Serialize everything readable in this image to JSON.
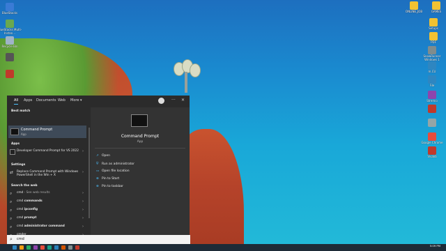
{
  "desktop": {
    "icons_left": [
      {
        "label": "BlueStacks",
        "color": "#3a7bd5"
      },
      {
        "label": "BlueStacks Multi-Instan...",
        "color": "#6aa84f"
      },
      {
        "label": "Recycle Bin",
        "color": "#9fb3c8"
      },
      {
        "label": "",
        "color": "#555555"
      },
      {
        "label": "",
        "color": "#c0392b"
      }
    ],
    "icons_right": [
      {
        "label": "ONLINE_JOB",
        "color": "#f1c232"
      },
      {
        "label": "GAMES",
        "color": "#f1c232"
      },
      {
        "label": "Setups",
        "color": "#f1c232"
      },
      {
        "label": "PDF",
        "color": "#f1c232"
      },
      {
        "label": "SnowRunner Windows 1",
        "color": "#7f8c8d"
      },
      {
        "label": "m.CU",
        "color": "#2e86c1"
      },
      {
        "label": "File",
        "color": "#2e86c1"
      },
      {
        "label": "Stremio",
        "color": "#8e44ad"
      },
      {
        "label": "",
        "color": "#c0392b"
      },
      {
        "label": "",
        "color": "#95a5a6"
      },
      {
        "label": "Google Chrome",
        "color": "#e74c3c"
      },
      {
        "label": "Vivaldi",
        "color": "#c0392b"
      }
    ]
  },
  "start": {
    "tabs": [
      "All",
      "Apps",
      "Documents",
      "Web",
      "More ▾"
    ],
    "more_icon": "···",
    "close_icon": "✕",
    "sections": {
      "best_match": "Best match",
      "apps": "Apps",
      "settings": "Settings",
      "search_web": "Search the web"
    },
    "best_match": {
      "title": "Command Prompt",
      "subtitle": "App"
    },
    "apps": [
      {
        "label": "Developer Command Prompt for VS 2022"
      }
    ],
    "settings": [
      {
        "label": "Replace Command Prompt with Windows PowerShell in the Win + X"
      }
    ],
    "web": [
      {
        "label": "cmd",
        "suffix": " - See web results"
      },
      {
        "label": "cmd ",
        "bold": "commands"
      },
      {
        "label": "cmd ",
        "bold": "ipconfig"
      },
      {
        "label": "cmd ",
        "bold": "prompt"
      },
      {
        "label": "cmd ",
        "bold": "administrator command"
      },
      {
        "label": "cmder",
        "bold": ""
      },
      {
        "label": "cmdb",
        "bold": ""
      }
    ],
    "detail": {
      "title": "Command Prompt",
      "subtitle": "App",
      "actions": [
        "Open",
        "Run as administrator",
        "Open file location",
        "Pin to Start",
        "Pin to taskbar"
      ]
    }
  },
  "search": {
    "query": "cmd"
  },
  "taskbar": {
    "time": "5:09 PM",
    "date": "",
    "apps": [
      "#2e86c1",
      "#f39c12",
      "#27ae60",
      "#8e44ad",
      "#e74c3c",
      "#16a085",
      "#2980b9",
      "#d35400",
      "#7f8c8d",
      "#c0392b"
    ]
  }
}
